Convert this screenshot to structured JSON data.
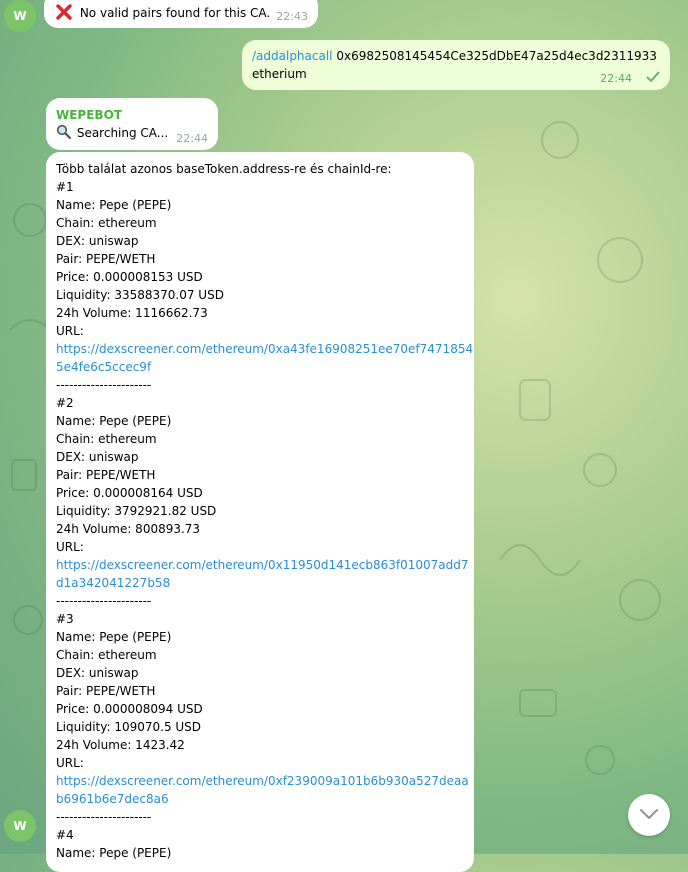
{
  "avatar_letter": "W",
  "msg_no_pairs": {
    "icon": "red-cross-icon",
    "text": "No valid pairs found for this CA.",
    "time": "22:43"
  },
  "msg_command": {
    "command": "/addalphacall",
    "address": "0x6982508145454Ce325dDbE47a25d4ec3d2311933",
    "network": "etherium",
    "time": "22:44"
  },
  "msg_searching": {
    "sender": "WEPEBOT",
    "icon": "magnifier-icon",
    "text": "Searching CA...",
    "time": "22:44"
  },
  "result": {
    "header": "Több találat azonos baseToken.address-re és chainId-re:",
    "separator": "----------------------",
    "entries": [
      {
        "num": "#1",
        "name": "Name: Pepe (PEPE)",
        "chain": "Chain: ethereum",
        "dex": "DEX: uniswap",
        "pair": "Pair: PEPE/WETH",
        "price": "Price: 0.000008153 USD",
        "liquidity": "Liquidity: 33588370.07 USD",
        "volume": "24h Volume: 1116662.73",
        "url_label": "URL:",
        "url_line1": "https://dexscreener.com/ethereum/0xa43fe16908251ee70ef7471854",
        "url_line2": "5e4fe6c5ccec9f"
      },
      {
        "num": "#2",
        "name": "Name: Pepe (PEPE)",
        "chain": "Chain: ethereum",
        "dex": "DEX: uniswap",
        "pair": "Pair: PEPE/WETH",
        "price": "Price: 0.000008164 USD",
        "liquidity": "Liquidity: 3792921.82 USD",
        "volume": "24h Volume: 800893.73",
        "url_label": "URL:",
        "url_line1": "https://dexscreener.com/ethereum/0x11950d141ecb863f01007add7",
        "url_line2": "d1a342041227b58"
      },
      {
        "num": "#3",
        "name": "Name: Pepe (PEPE)",
        "chain": "Chain: ethereum",
        "dex": "DEX: uniswap",
        "pair": "Pair: PEPE/WETH",
        "price": "Price: 0.000008094 USD",
        "liquidity": "Liquidity: 109070.5 USD",
        "volume": "24h Volume: 1423.42",
        "url_label": "URL:",
        "url_line1": "https://dexscreener.com/ethereum/0xf239009a101b6b930a527deaa",
        "url_line2": "b6961b6e7dec8a6"
      }
    ],
    "entry4_num": "#4",
    "entry4_name_partial": "Name: Pepe (PEPE)"
  },
  "scroll_button_icon": "chevron-down-icon"
}
